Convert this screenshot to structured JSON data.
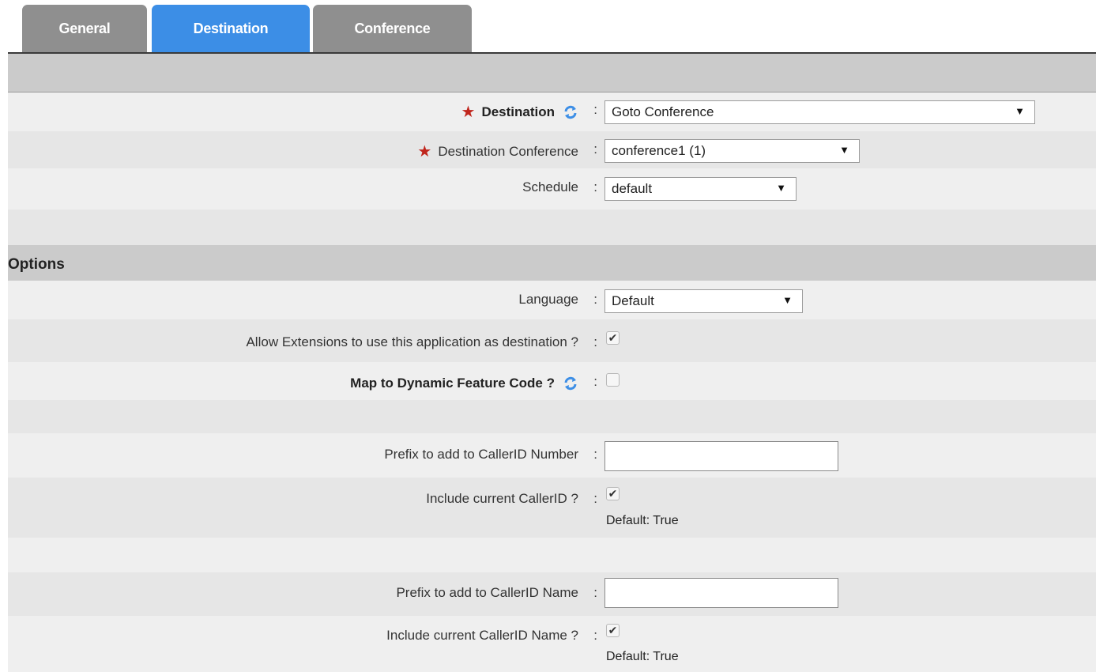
{
  "tabs": [
    {
      "label": "General",
      "active": false
    },
    {
      "label": "Destination",
      "active": true
    },
    {
      "label": "Conference",
      "active": false
    }
  ],
  "destination": {
    "label": "Destination",
    "value": "Goto Conference"
  },
  "destination_conference": {
    "label": "Destination Conference",
    "value": "conference1 (1)"
  },
  "schedule": {
    "label": "Schedule",
    "value": "default"
  },
  "options": {
    "title": "Options",
    "language": {
      "label": "Language",
      "value": "Default"
    },
    "allow_extensions": {
      "label": "Allow Extensions to use this application as destination ?",
      "checked": true
    },
    "map_dynamic": {
      "label": "Map to Dynamic Feature Code ?",
      "checked": false
    },
    "prefix_number": {
      "label": "Prefix to add to CallerID Number",
      "value": ""
    },
    "include_callerid": {
      "label": "Include current CallerID ?",
      "checked": true,
      "note": "Default: True"
    },
    "prefix_name": {
      "label": "Prefix to add to CallerID Name",
      "value": ""
    },
    "include_callerid_name": {
      "label": "Include current CallerID Name ?",
      "checked": true,
      "note": "Default: True"
    }
  },
  "colon": ":",
  "required_mark": "★",
  "dropdown_arrow": "▼",
  "check_mark": "✔",
  "colors": {
    "active_tab": "#3c8ee6",
    "inactive_tab": "#8f8f8f",
    "required": "#c0251c",
    "refresh_icon": "#3c8ee6"
  }
}
